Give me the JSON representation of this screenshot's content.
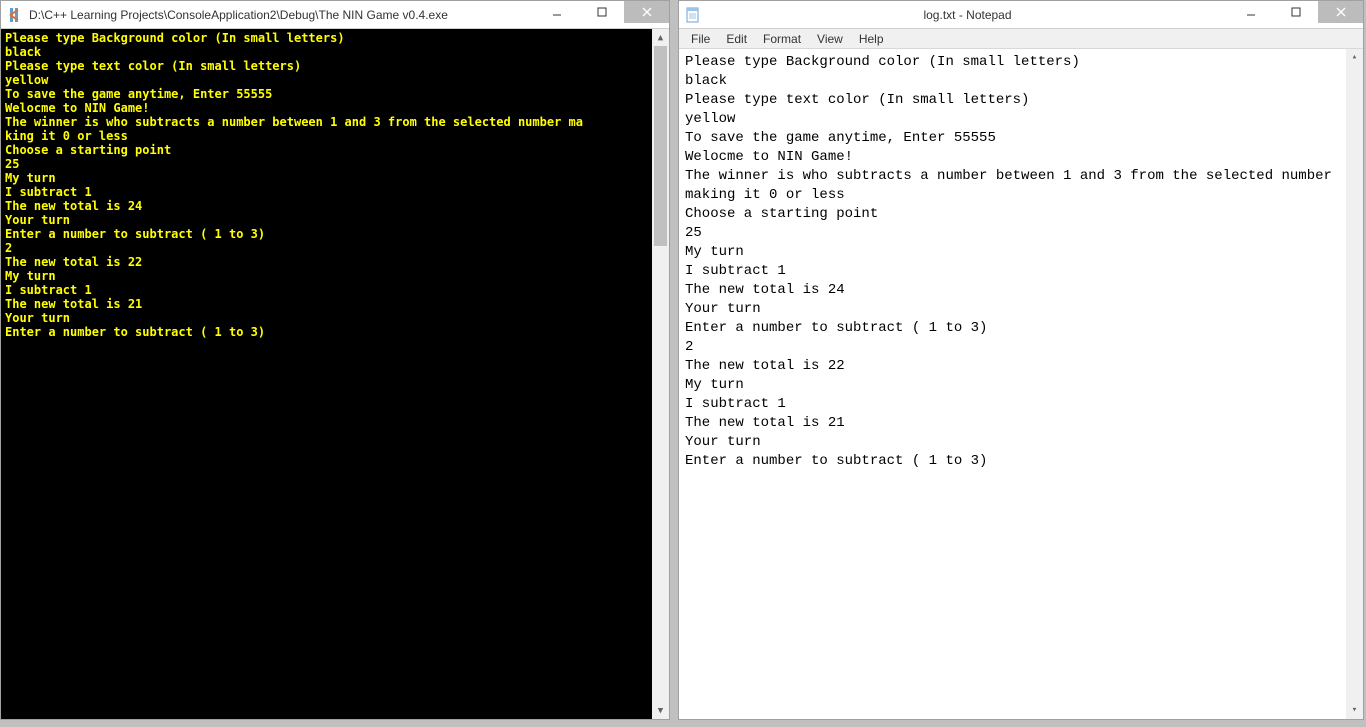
{
  "console": {
    "title": "D:\\C++ Learning Projects\\ConsoleApplication2\\Debug\\The NIN Game v0.4.exe",
    "bg_color": "#000000",
    "fg_color": "#ffff00",
    "lines": [
      "Please type Background color (In small letters)",
      "black",
      "Please type text color (In small letters)",
      "yellow",
      "To save the game anytime, Enter 55555",
      "Welocme to NIN Game!",
      "The winner is who subtracts a number between 1 and 3 from the selected number ma",
      "king it 0 or less",
      "Choose a starting point",
      "25",
      "My turn",
      "I subtract 1",
      "The new total is 24",
      "Your turn",
      "Enter a number to subtract ( 1 to 3)",
      "2",
      "The new total is 22",
      "My turn",
      "I subtract 1",
      "The new total is 21",
      "Your turn",
      "Enter a number to subtract ( 1 to 3)"
    ]
  },
  "notepad": {
    "title": "log.txt - Notepad",
    "menu": {
      "file": "File",
      "edit": "Edit",
      "format": "Format",
      "view": "View",
      "help": "Help"
    },
    "lines": [
      "Please type Background color (In small letters)",
      "black",
      "Please type text color (In small letters)",
      "yellow",
      "To save the game anytime, Enter 55555",
      "Welocme to NIN Game!",
      "The winner is who subtracts a number between 1 and 3 from the selected number making it 0 or less",
      "Choose a starting point",
      "25",
      "My turn",
      "I subtract 1",
      "The new total is 24",
      "Your turn",
      "Enter a number to subtract ( 1 to 3)",
      "2",
      "The new total is 22",
      "My turn",
      "I subtract 1",
      "The new total is 21",
      "Your turn",
      "Enter a number to subtract ( 1 to 3)"
    ]
  }
}
